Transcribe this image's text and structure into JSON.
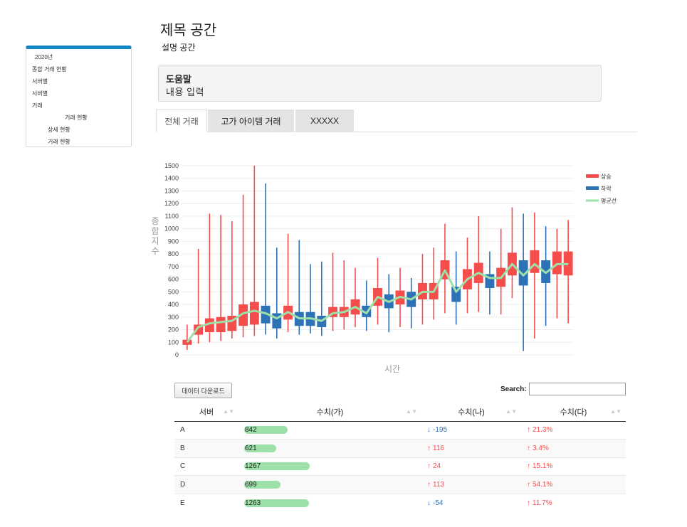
{
  "header": {
    "title": "제목 공간",
    "subtitle": "설명 공간"
  },
  "help": {
    "heading": "도움말",
    "body": "내용 입력"
  },
  "sidebar": {
    "items": [
      {
        "label": "2020년",
        "indent": 12
      },
      {
        "label": "종합 거래 현황",
        "indent": 8
      },
      {
        "label": "서버별",
        "indent": 8
      },
      {
        "label": "서버별",
        "indent": 8
      },
      {
        "label": "거래",
        "indent": 8
      },
      {
        "label": "거래 현황",
        "indent": 54
      },
      {
        "label": "상세 현황",
        "indent": 30
      },
      {
        "label": "거래 현황",
        "indent": 30
      }
    ]
  },
  "tabs": [
    {
      "label": "전체 거래",
      "active": true
    },
    {
      "label": "고가 아이템 거래",
      "active": false
    },
    {
      "label": "XXXXX",
      "active": false
    }
  ],
  "colors": {
    "up": "#f54c4c",
    "down": "#2d72b7",
    "avg": "#9de0a8",
    "accent": "#1088c4"
  },
  "chart_data": {
    "type": "candlestick",
    "ylabel": "종합지수",
    "xlabel": "시간",
    "ylim": [
      0,
      1500
    ],
    "yticks": [
      0,
      100,
      200,
      300,
      400,
      500,
      600,
      700,
      800,
      900,
      1000,
      1100,
      1200,
      1300,
      1400,
      1500
    ],
    "grid": true,
    "legend_position": "right",
    "legend": [
      {
        "label": "상승",
        "color": "#f54c4c"
      },
      {
        "label": "하락",
        "color": "#2d72b7"
      },
      {
        "label": "평균선",
        "color": "#9de0a8"
      }
    ],
    "candles": [
      {
        "open": 80,
        "close": 120,
        "low": 40,
        "high": 240,
        "dir": "up"
      },
      {
        "open": 160,
        "close": 240,
        "low": 90,
        "high": 840,
        "dir": "up"
      },
      {
        "open": 180,
        "close": 290,
        "low": 100,
        "high": 1120,
        "dir": "up"
      },
      {
        "open": 180,
        "close": 300,
        "low": 110,
        "high": 1110,
        "dir": "up"
      },
      {
        "open": 190,
        "close": 310,
        "low": 130,
        "high": 1060,
        "dir": "up"
      },
      {
        "open": 230,
        "close": 400,
        "low": 140,
        "high": 1270,
        "dir": "up"
      },
      {
        "open": 240,
        "close": 420,
        "low": 150,
        "high": 1500,
        "dir": "up"
      },
      {
        "open": 390,
        "close": 250,
        "low": 160,
        "high": 1360,
        "dir": "down"
      },
      {
        "open": 330,
        "close": 210,
        "low": 130,
        "high": 850,
        "dir": "down"
      },
      {
        "open": 280,
        "close": 390,
        "low": 180,
        "high": 960,
        "dir": "up"
      },
      {
        "open": 340,
        "close": 230,
        "low": 160,
        "high": 910,
        "dir": "down"
      },
      {
        "open": 340,
        "close": 230,
        "low": 170,
        "high": 720,
        "dir": "down"
      },
      {
        "open": 310,
        "close": 220,
        "low": 150,
        "high": 740,
        "dir": "down"
      },
      {
        "open": 300,
        "close": 380,
        "low": 190,
        "high": 810,
        "dir": "up"
      },
      {
        "open": 300,
        "close": 380,
        "low": 200,
        "high": 750,
        "dir": "up"
      },
      {
        "open": 320,
        "close": 440,
        "low": 220,
        "high": 690,
        "dir": "up"
      },
      {
        "open": 390,
        "close": 300,
        "low": 190,
        "high": 590,
        "dir": "down"
      },
      {
        "open": 390,
        "close": 530,
        "low": 240,
        "high": 770,
        "dir": "up"
      },
      {
        "open": 480,
        "close": 370,
        "low": 180,
        "high": 640,
        "dir": "down"
      },
      {
        "open": 400,
        "close": 510,
        "low": 220,
        "high": 690,
        "dir": "up"
      },
      {
        "open": 500,
        "close": 380,
        "low": 210,
        "high": 610,
        "dir": "down"
      },
      {
        "open": 440,
        "close": 570,
        "low": 240,
        "high": 800,
        "dir": "up"
      },
      {
        "open": 440,
        "close": 570,
        "low": 280,
        "high": 850,
        "dir": "up"
      },
      {
        "open": 600,
        "close": 750,
        "low": 330,
        "high": 1040,
        "dir": "up"
      },
      {
        "open": 540,
        "close": 420,
        "low": 240,
        "high": 820,
        "dir": "down"
      },
      {
        "open": 520,
        "close": 680,
        "low": 330,
        "high": 930,
        "dir": "up"
      },
      {
        "open": 570,
        "close": 730,
        "low": 340,
        "high": 1100,
        "dir": "up"
      },
      {
        "open": 640,
        "close": 530,
        "low": 320,
        "high": 820,
        "dir": "down"
      },
      {
        "open": 540,
        "close": 690,
        "low": 320,
        "high": 1000,
        "dir": "up"
      },
      {
        "open": 630,
        "close": 810,
        "low": 450,
        "high": 1170,
        "dir": "up"
      },
      {
        "open": 750,
        "close": 550,
        "low": 30,
        "high": 1120,
        "dir": "down"
      },
      {
        "open": 650,
        "close": 830,
        "low": 130,
        "high": 1130,
        "dir": "up"
      },
      {
        "open": 750,
        "close": 570,
        "low": 230,
        "high": 1020,
        "dir": "down"
      },
      {
        "open": 640,
        "close": 820,
        "low": 290,
        "high": 1000,
        "dir": "up"
      },
      {
        "open": 630,
        "close": 820,
        "low": 250,
        "high": 1070,
        "dir": "up"
      }
    ],
    "avg_line": [
      100,
      220,
      250,
      260,
      270,
      330,
      350,
      330,
      290,
      340,
      290,
      290,
      270,
      330,
      340,
      380,
      330,
      460,
      420,
      460,
      440,
      500,
      500,
      670,
      500,
      600,
      650,
      610,
      610,
      720,
      630,
      720,
      650,
      720,
      720
    ]
  },
  "table": {
    "download_label": "데이터 다운로드",
    "search_label": "Search:",
    "search_value": "",
    "columns": [
      "서버",
      "수치(가)",
      "수치(나)",
      "수치(다)"
    ],
    "rows": [
      {
        "server": "A",
        "value_a": "842",
        "bar_fraction": 0.66,
        "value_b": "-195",
        "b_dir": "down",
        "value_c": "21.3%",
        "c_dir": "up"
      },
      {
        "server": "B",
        "value_a": "621",
        "bar_fraction": 0.49,
        "value_b": "116",
        "b_dir": "up",
        "value_c": "3.4%",
        "c_dir": "up"
      },
      {
        "server": "C",
        "value_a": "1267",
        "bar_fraction": 1.0,
        "value_b": "24",
        "b_dir": "up",
        "value_c": "15.1%",
        "c_dir": "up"
      },
      {
        "server": "D",
        "value_a": "699",
        "bar_fraction": 0.55,
        "value_b": "113",
        "b_dir": "up",
        "value_c": "54.1%",
        "c_dir": "up"
      },
      {
        "server": "E",
        "value_a": "1263",
        "bar_fraction": 0.99,
        "value_b": "-54",
        "b_dir": "down",
        "value_c": "11.7%",
        "c_dir": "up"
      }
    ]
  }
}
